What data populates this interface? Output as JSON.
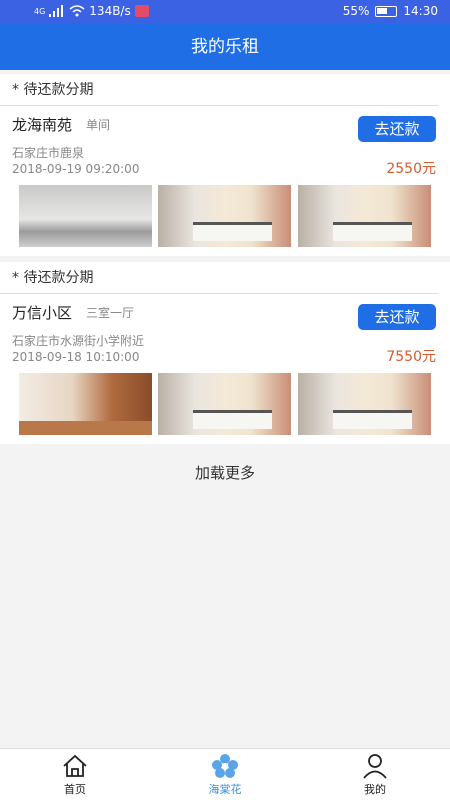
{
  "status": {
    "network": "4G",
    "speed": "134B/s",
    "battery": "55%",
    "time": "14:30"
  },
  "nav": {
    "title": "我的乐租"
  },
  "orders": [
    {
      "section_label": "* 待还款分期",
      "name": "龙海南苑",
      "type": "单间",
      "button": "去还款",
      "address": "石家庄市鹿泉",
      "date": "2018-09-19 09:20:00",
      "price": "2550元",
      "images": [
        "living-room-photo",
        "bedroom-photo",
        "bedroom-photo"
      ]
    },
    {
      "section_label": "* 待还款分期",
      "name": "万信小区",
      "type": "三室一厅",
      "button": "去还款",
      "address": "石家庄市水源街小学附近",
      "date": "2018-09-18 10:10:00",
      "price": "7550元",
      "images": [
        "wooden-living-room-photo",
        "bedroom-photo",
        "bedroom-photo"
      ]
    }
  ],
  "load_more": "加载更多",
  "tabs": [
    {
      "label": "首页",
      "icon": "home-icon"
    },
    {
      "label": "海棠花",
      "icon": "flower-icon",
      "active": true
    },
    {
      "label": "我的",
      "icon": "person-icon"
    }
  ],
  "colors": {
    "nav": "#1f6ee6",
    "status": "#3a62e3",
    "price": "#d25d2b",
    "active_tab": "#3d8fe0"
  }
}
